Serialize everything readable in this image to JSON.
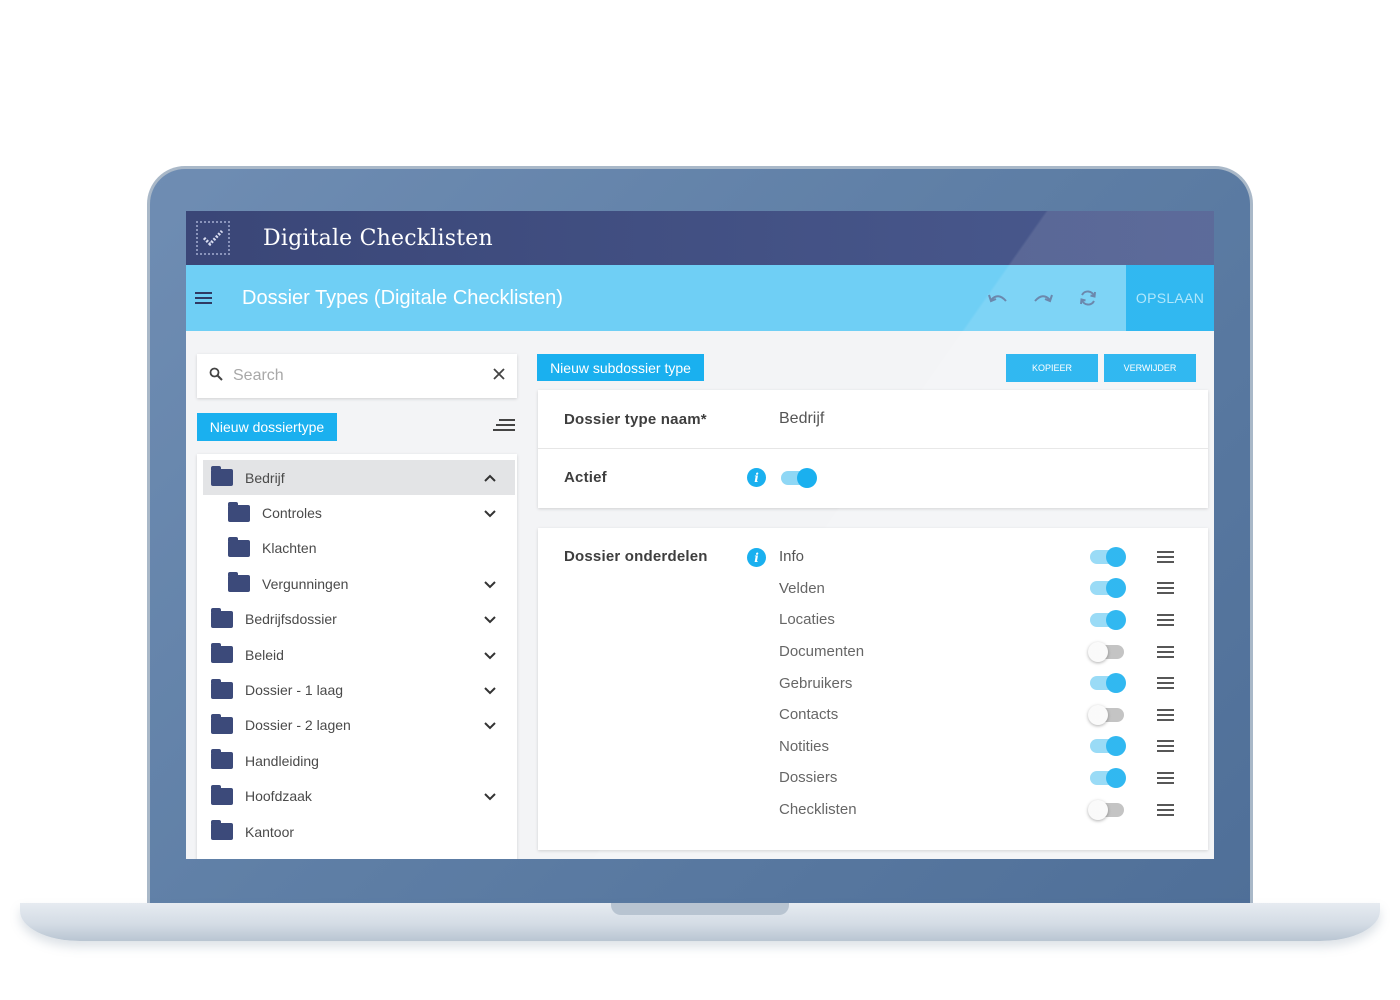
{
  "app": {
    "title": "Digitale Checklisten"
  },
  "toolbar": {
    "page_title": "Dossier Types (Digitale Checklisten)",
    "save_label": "OPSLAAN"
  },
  "left": {
    "search_placeholder": "Search",
    "new_type_label": "Nieuw dossiertype",
    "tree": [
      {
        "label": "Bedrijf",
        "level": 0,
        "expanded": true,
        "selected": true,
        "has_children": true
      },
      {
        "label": "Controles",
        "level": 1,
        "has_children": true
      },
      {
        "label": "Klachten",
        "level": 1,
        "has_children": false
      },
      {
        "label": "Vergunningen",
        "level": 1,
        "has_children": true
      },
      {
        "label": "Bedrijfsdossier",
        "level": 0,
        "has_children": true
      },
      {
        "label": "Beleid",
        "level": 0,
        "has_children": true
      },
      {
        "label": "Dossier - 1 laag",
        "level": 0,
        "has_children": true
      },
      {
        "label": "Dossier - 2 lagen",
        "level": 0,
        "has_children": true
      },
      {
        "label": "Handleiding",
        "level": 0,
        "has_children": false
      },
      {
        "label": "Hoofdzaak",
        "level": 0,
        "has_children": true
      },
      {
        "label": "Kantoor",
        "level": 0,
        "has_children": false
      }
    ]
  },
  "right": {
    "new_subtype_label": "Nieuw subdossier type",
    "copy_label": "KOPIEER",
    "delete_label": "VERWIJDER",
    "name_label": "Dossier type naam*",
    "name_value": "Bedrijf",
    "active_label": "Actief",
    "active": true,
    "parts_label": "Dossier onderdelen",
    "parts": [
      {
        "name": "Info",
        "enabled": true
      },
      {
        "name": "Velden",
        "enabled": true
      },
      {
        "name": "Locaties",
        "enabled": true
      },
      {
        "name": "Documenten",
        "enabled": false
      },
      {
        "name": "Gebruikers",
        "enabled": true
      },
      {
        "name": "Contacts",
        "enabled": false
      },
      {
        "name": "Notities",
        "enabled": true
      },
      {
        "name": "Dossiers",
        "enabled": true
      },
      {
        "name": "Checklisten",
        "enabled": false
      }
    ]
  },
  "colors": {
    "header": "#3a4677",
    "accent": "#1ab0ef",
    "toolbar": "#6fcff5",
    "folder": "#3c4a7a"
  }
}
